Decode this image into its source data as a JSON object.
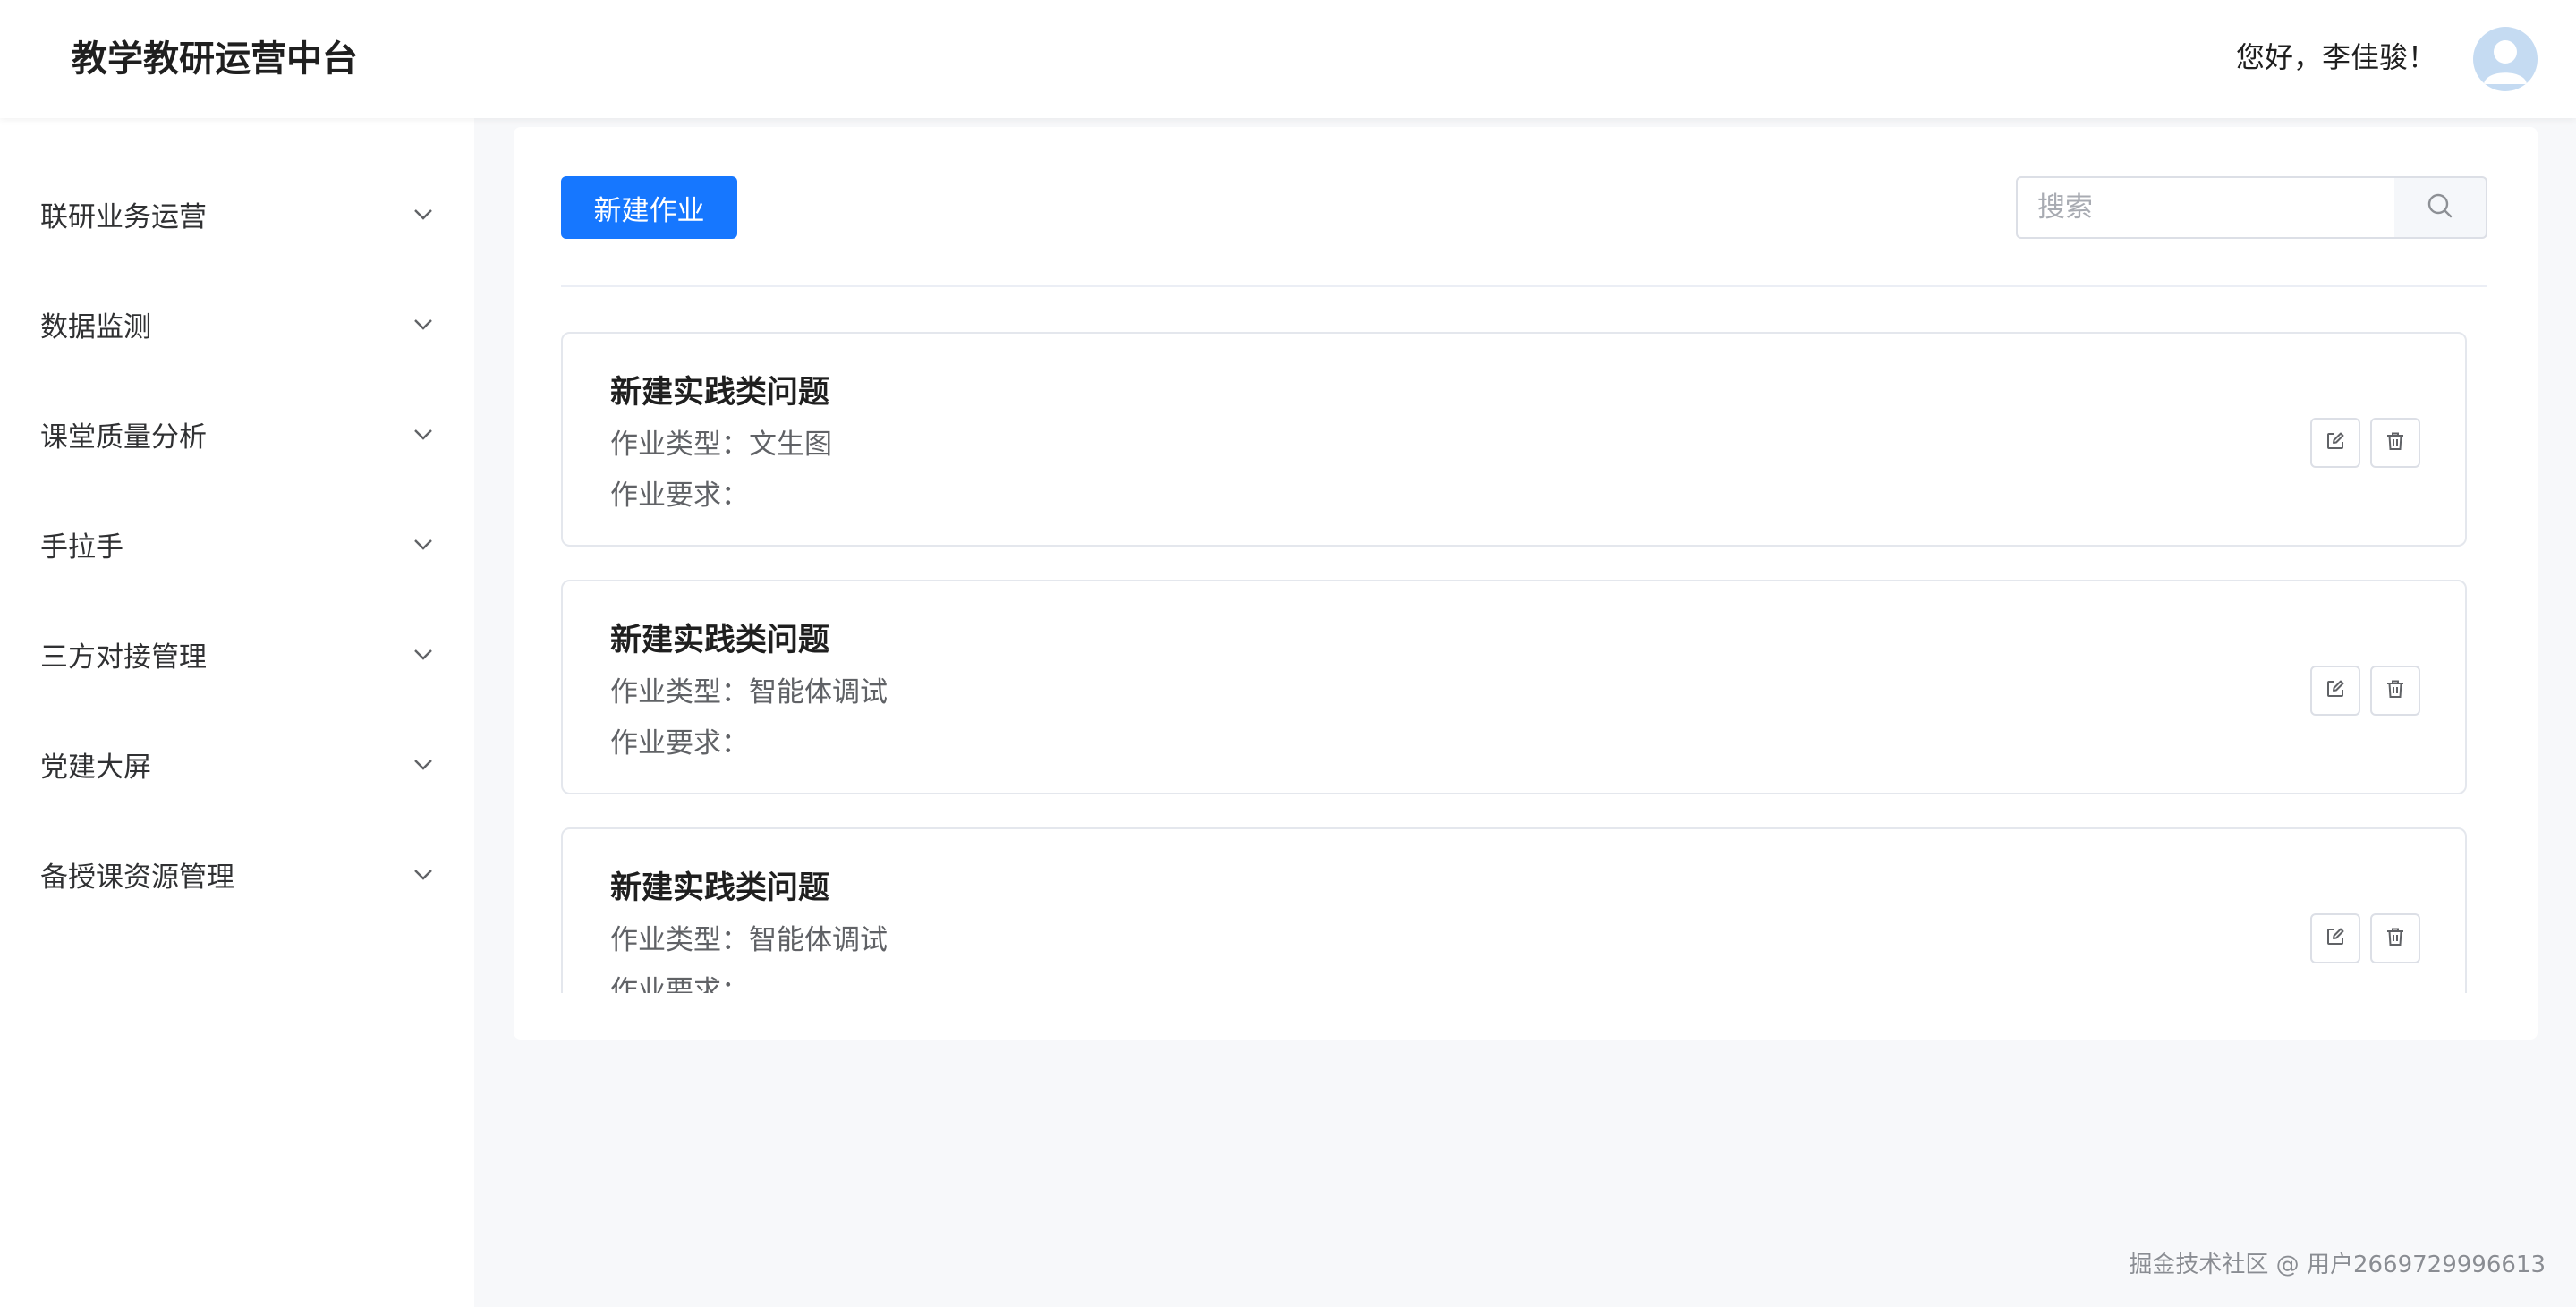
{
  "header": {
    "app_title": "教学教研运营中台",
    "greeting": "您好，李佳骏！"
  },
  "sidebar": {
    "items": [
      {
        "label": "联研业务运营"
      },
      {
        "label": "数据监测"
      },
      {
        "label": "课堂质量分析"
      },
      {
        "label": "手拉手"
      },
      {
        "label": "三方对接管理"
      },
      {
        "label": "党建大屏"
      },
      {
        "label": "备授课资源管理"
      }
    ]
  },
  "toolbar": {
    "new_button_label": "新建作业",
    "search_placeholder": "搜索",
    "search_value": ""
  },
  "assignments": [
    {
      "title": "新建实践类问题",
      "type_text": "作业类型：文生图",
      "requirement_text": "作业要求："
    },
    {
      "title": "新建实践类问题",
      "type_text": "作业类型：智能体调试",
      "requirement_text": "作业要求："
    },
    {
      "title": "新建实践类问题",
      "type_text": "作业类型：智能体调试",
      "requirement_text": "作业要求："
    }
  ],
  "icons": {
    "menu_chevron": "chevron-down-icon",
    "search": "search-icon",
    "edit": "edit-icon",
    "delete": "trash-icon",
    "avatar": "user-avatar-icon"
  },
  "colors": {
    "primary": "#1677ff",
    "page_background": "#f7f8fa",
    "avatar_background": "#c5dbf2"
  },
  "watermark": "掘金技术社区 @ 用户2669729996613"
}
